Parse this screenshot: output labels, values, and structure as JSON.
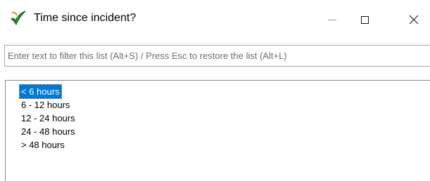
{
  "window": {
    "title": "Time since incident?",
    "icon": "green-checkmark-app-icon",
    "controls": {
      "minimize": "minimize",
      "maximize": "maximize",
      "close": "close"
    }
  },
  "filter": {
    "placeholder": "Enter text to filter this list (Alt+S) / Press Esc to restore the list (Alt+L)",
    "value": ""
  },
  "list": {
    "selected_index": 0,
    "selected_color": "#0078d7",
    "items": [
      {
        "label": "< 6 hours"
      },
      {
        "label": "6 - 12 hours"
      },
      {
        "label": "12 - 24 hours"
      },
      {
        "label": "24 - 48 hours"
      },
      {
        "label": "> 48 hours"
      }
    ]
  }
}
